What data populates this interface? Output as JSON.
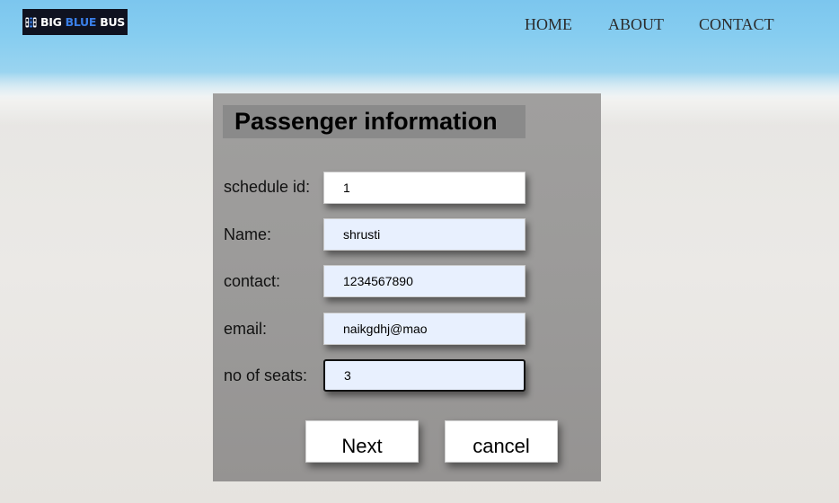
{
  "header": {
    "logo": {
      "text_white": "BIG",
      "text_blue": "BLUE",
      "text_end": "BUS",
      "brand_blue": "#3a7fe8"
    },
    "nav": [
      {
        "label": "HOME"
      },
      {
        "label": "ABOUT"
      },
      {
        "label": "CONTACT"
      }
    ]
  },
  "form": {
    "title": "Passenger information",
    "fields": [
      {
        "label": "schedule id:",
        "value": "1"
      },
      {
        "label": "Name:",
        "value": "shrusti"
      },
      {
        "label": "contact:",
        "value": "1234567890"
      },
      {
        "label": "email:",
        "value": "naikgdhj@mao"
      },
      {
        "label": "no of seats:",
        "value": "3"
      }
    ],
    "next_label": "Next",
    "cancel_label": "cancel"
  }
}
